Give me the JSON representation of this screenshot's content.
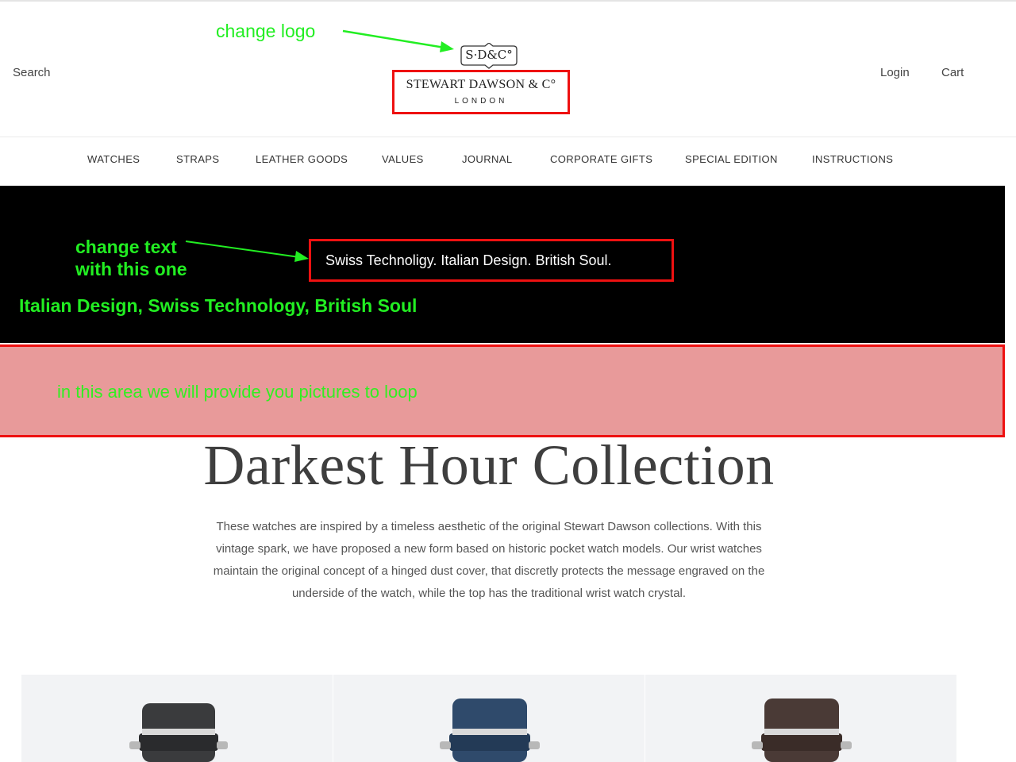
{
  "header": {
    "search_label": "Search",
    "login_label": "Login",
    "cart_label": "Cart",
    "logo": {
      "monogram": "S·D&C°",
      "name": "STEWART DAWSON & C°",
      "city": "LONDON"
    }
  },
  "annotations": {
    "change_logo": "change logo",
    "change_text": "change text\nwith this one",
    "replacement": "Italian Design, Swiss Technology, British Soul",
    "carousel_note": "in this area we will provide you pictures to loop"
  },
  "nav": {
    "items": [
      "WATCHES",
      "STRAPS",
      "LEATHER GOODS",
      "VALUES",
      "JOURNAL",
      "CORPORATE GIFTS",
      "SPECIAL EDITION",
      "INSTRUCTIONS"
    ]
  },
  "banner": {
    "tagline": "Swiss Technoligy.  Italian Design.  British Soul."
  },
  "collection": {
    "title": "Darkest Hour Collection",
    "description": "These watches are inspired by a timeless aesthetic of the original Stewart Dawson collections. With this vintage spark, we have proposed a new form based on historic pocket watch models. Our wrist watches maintain the original concept of a hinged dust cover, that discretly protects the message engraved on the underside of the watch, while the top has the traditional wrist watch crystal."
  },
  "products": [
    {
      "strap_color": "#3a3b3d"
    },
    {
      "strap_color": "#2f4a6b"
    },
    {
      "strap_color": "#4a3a36"
    }
  ],
  "colors": {
    "annotation_green": "#22ee22",
    "highlight_red": "#ee1111",
    "carousel_pink": "#e89a9a",
    "banner_black": "#000000"
  }
}
